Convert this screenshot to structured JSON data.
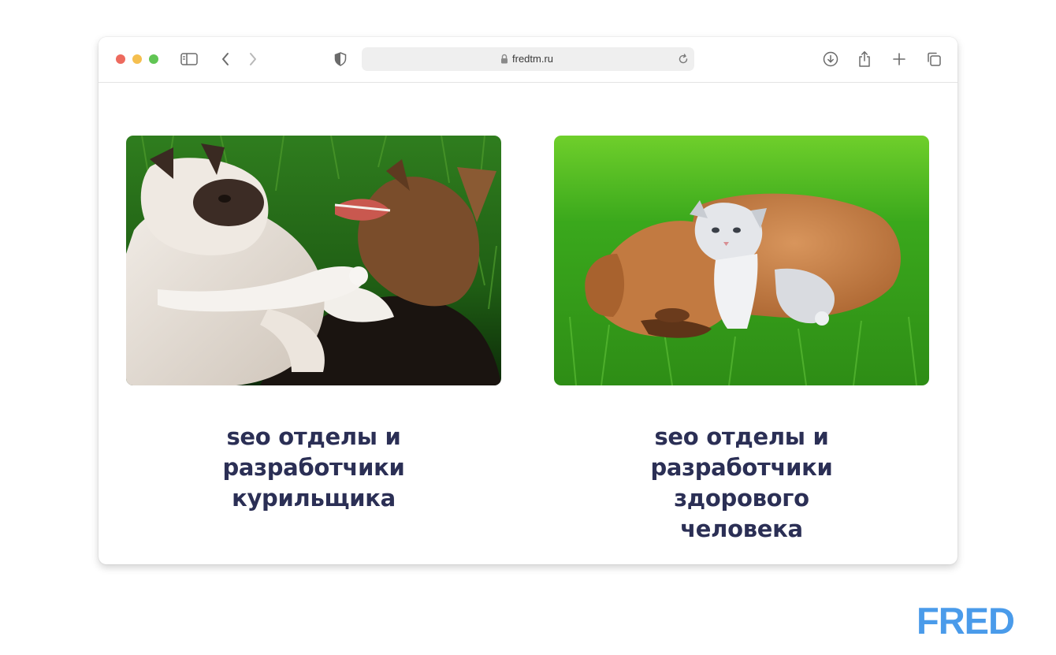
{
  "browser": {
    "url": "fredtm.ru",
    "icons": {
      "sidebar": "sidebar-icon",
      "back": "chevron-left-icon",
      "forward": "chevron-right-icon",
      "privacy": "shield-icon",
      "lock": "lock-icon",
      "reload": "reload-icon",
      "download": "download-icon",
      "share": "share-icon",
      "new_tab": "plus-icon",
      "tabs": "tabs-overview-icon"
    },
    "traffic_lights": [
      "#ed6a5e",
      "#f5bf4f",
      "#61c554"
    ]
  },
  "cards": [
    {
      "image": "cat-fighting-dog-photo",
      "caption_lines": [
        "seo отделы и",
        "разработчики",
        "курильщика"
      ]
    },
    {
      "image": "kitten-hugging-puppy-photo",
      "caption_lines": [
        "seo отделы и",
        "разработчики",
        "здорового",
        "человека"
      ]
    }
  ],
  "brand": {
    "logo_text": "FRED",
    "color": "#4a9bea"
  },
  "colors": {
    "caption": "#2b2f55"
  }
}
